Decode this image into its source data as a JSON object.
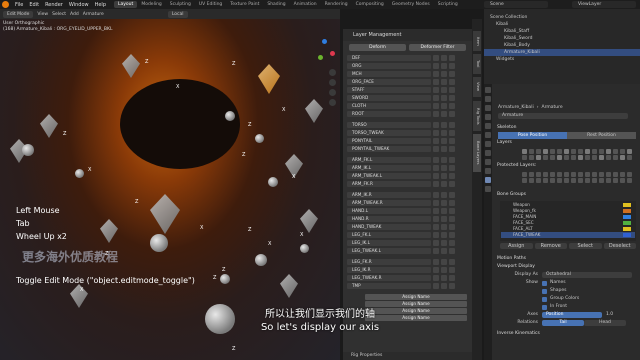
{
  "menu": {
    "file": "File",
    "edit": "Edit",
    "render": "Render",
    "window": "Window",
    "help": "Help"
  },
  "workspaces": [
    "Layout",
    "Modeling",
    "Sculpting",
    "UV Editing",
    "Texture Paint",
    "Shading",
    "Animation",
    "Rendering",
    "Compositing",
    "Geometry Nodes",
    "Scripting"
  ],
  "scene": "Scene",
  "view_layer": "ViewLayer",
  "viewport": {
    "mode": "Edit Mode",
    "view": "View",
    "select": "Select",
    "add": "Add",
    "armature": "Armature",
    "orientation": "Local",
    "info_line1": "User Orthographic",
    "info_line2": "(168) Armature_Kibali : ORG_EYELID_UPPER_BKL",
    "keys": [
      "Left Mouse",
      "Tab",
      "Wheel Up x2"
    ],
    "operator": "Toggle Edit Mode (\"object.editmode_toggle\")",
    "watermark": "更多海外优质教程",
    "axis_labels": [
      "Z",
      "X",
      "Z",
      "X",
      "Z",
      "Z",
      "X",
      "Z",
      "X",
      "Z",
      "X",
      "Z",
      "Z",
      "X",
      "Z",
      "X",
      "Z",
      "X",
      "Z"
    ]
  },
  "layer_panel": {
    "title": "Layer Management",
    "deform": "Deform",
    "deformer_filter": "Deformer Filter",
    "groups": [
      [
        "DEF",
        "ORG",
        "MCH",
        "ORG_FACE",
        "STAFF",
        "SWORD",
        "CLOTH",
        "ROOT"
      ],
      [
        "TORSO",
        "TORSO_TWEAK",
        "PONYTAIL",
        "PONYTAIL_TWEAK"
      ],
      [
        "ARM_FK.L",
        "ARM_IK.L",
        "ARM_TWEAK.L",
        "ARM_FK.R"
      ],
      [
        "ARM_IK.R",
        "ARM_TWEAK.R",
        "HAND.L",
        "HAND.R",
        "HAND_TWEAK",
        "LEG_FK.L",
        "LEG_IK.L",
        "LEG_TWEAK.L"
      ],
      [
        "LEG_FK.R",
        "LEG_IK.R",
        "LEG_TWEAK.R",
        "TMP"
      ]
    ],
    "assign_name": "Assign Name",
    "rig_properties": "Rig Properties"
  },
  "side_tabs": [
    "Item",
    "Tool",
    "View",
    "Rig Tools",
    "Bone Layers"
  ],
  "outliner": {
    "items": [
      "Scene Collection",
      "Kibali",
      "Kibali_Staff",
      "Kibali_Sword",
      "Kibali_Body",
      "Armature_Kibali",
      "Widgets"
    ]
  },
  "properties": {
    "object": "Armature_Kibali",
    "data": "Armature",
    "data_field": "Armature",
    "skeleton": "Skeleton",
    "pose_position": "Pose Position",
    "rest_position": "Rest Position",
    "layers": "Layers",
    "protected_layers": "Protected Layers:",
    "bone_groups": "Bone Groups",
    "bone_group_items": [
      "Weapon",
      "Weapon_fk",
      "FACE_MAIN",
      "FACE_SEC",
      "FACE_ALT",
      "FACE_TWEAK"
    ],
    "bone_group_colors": [
      "#e0c020",
      "#d07020",
      "#3080e0",
      "#50b040",
      "#e0c020",
      "#3060d0"
    ],
    "assign": "Assign",
    "remove": "Remove",
    "select": "Select",
    "deselect": "Deselect",
    "motion_paths": "Motion Paths",
    "viewport_display": "Viewport Display",
    "display_as_label": "Display As",
    "display_as": "Octahedral",
    "show_label": "Show",
    "show_names": "Names",
    "show_shapes": "Shapes",
    "show_group_colors": "Group Colors",
    "show_in_front": "In Front",
    "axes_label": "Axes",
    "axes_position": "Position",
    "axes_value": "1.0",
    "relations_label": "Relations",
    "relation_tail": "Tail",
    "relation_head": "Head",
    "inverse_kinematics": "Inverse Kinematics"
  },
  "subtitles": {
    "cn": "所以让我们显示我们的轴",
    "en": "So let's display our axis"
  }
}
